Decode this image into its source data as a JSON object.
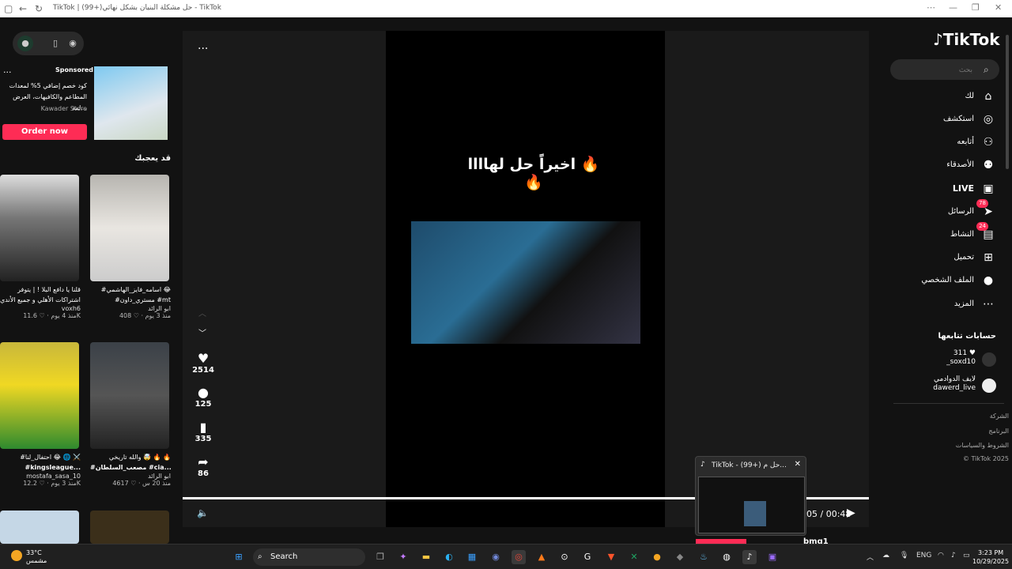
{
  "window": {
    "title": "TikTok | حل مشكلة البنيان بشكل نهائي(+99) - TikTok"
  },
  "ad": {
    "sponsored": "Sponsored",
    "text": "كود خصم إضافي 5% لمعدات المطاعم والكافيهات، العرض لمد...",
    "store": "Kawader Store",
    "cta": "Order now",
    "more": "..."
  },
  "sidebar_left": {
    "may_like": "قد يعجبك"
  },
  "cards": [
    {
      "caption1": "قلنا يا دافع البلا ! | يتوفر",
      "caption2": "اشتراكات الأهلي و جميع الأندي...",
      "user": "voxh6",
      "likes": "11.6K",
      "age": "منذ 4 يوم"
    },
    {
      "caption1": "#اسامه_فايز_الهاشمي 😂",
      "caption2": "#مستري_داون #mt",
      "user": "ابو الرائد",
      "likes": "408",
      "age": "منذ 3 يوم"
    },
    {
      "caption1": "#احتفال_لنا 😂 🌐 ⚔️",
      "caption2": "#kingsleague...",
      "user": "mostafa_sasa_10",
      "likes": "12.2K",
      "age": "منذ 3 يوم"
    },
    {
      "caption1": "والله تاريخي 🤯 🔥 🔥",
      "caption2": "#مصعب_السلطان #cia...",
      "user": "ابو الرائد",
      "likes": "4617",
      "age": "منذ 20 س"
    }
  ],
  "video": {
    "title": "اخيراً حل لهاااا 🔥🔥",
    "more": "...",
    "likes": "2514",
    "comments": "125",
    "saves": "335",
    "shares": "86",
    "time": "05 / 00:48"
  },
  "pip": {
    "title": "TikTok - (99+) حل م..."
  },
  "logo": "TikTok",
  "search": {
    "placeholder": "بحث"
  },
  "nav": [
    {
      "label": "لك",
      "icon": "home-icon"
    },
    {
      "label": "استكشف",
      "icon": "compass-icon"
    },
    {
      "label": "أتابعه",
      "icon": "user-plus-icon"
    },
    {
      "label": "الأصدقاء",
      "icon": "friends-icon"
    },
    {
      "label": "LIVE",
      "icon": "live-icon"
    },
    {
      "label": "الرسائل",
      "icon": "send-icon",
      "badge": "78"
    },
    {
      "label": "النشاط",
      "icon": "activity-icon",
      "badge": "24"
    },
    {
      "label": "تحميل",
      "icon": "upload-icon"
    },
    {
      "label": "الملف الشخصي",
      "icon": "avatar-icon"
    },
    {
      "label": "المزيد",
      "icon": "more-icon"
    }
  ],
  "following": {
    "title": "حسابات تتابعها",
    "accounts": [
      {
        "name": "311 ♥",
        "handle": "_soxd10"
      },
      {
        "name": "لايف الدوادمي",
        "handle": "dawerd_live"
      }
    ]
  },
  "footer": [
    "الشركة",
    "البرنامج",
    "الشروط والسياسات",
    "© TikTok 2025"
  ],
  "taskbar": {
    "weather_temp": "33°C",
    "weather_desc": "مشمس",
    "search_label": "Search",
    "lang": "ENG",
    "time": "3:23 PM",
    "date": "10/29/2025",
    "peek_user": "bmq1"
  },
  "colors": {
    "accent": "#fe2c55"
  }
}
